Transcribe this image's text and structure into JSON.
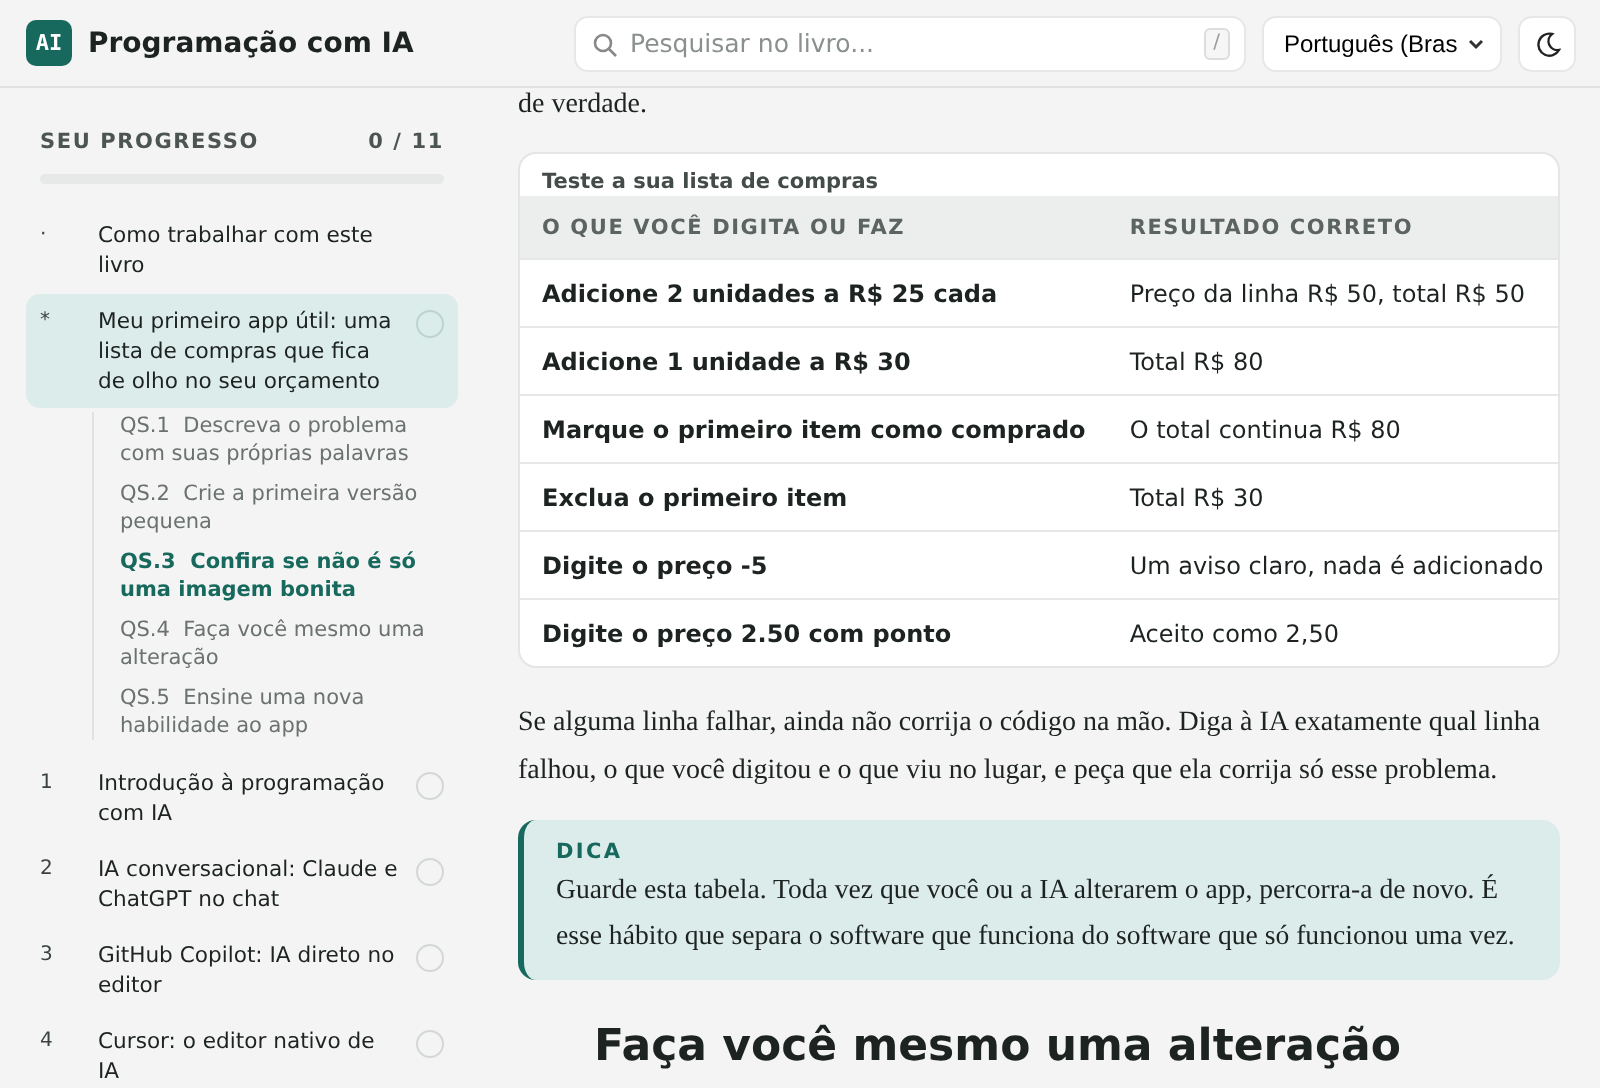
{
  "header": {
    "logo": "AI",
    "title": "Programação com IA",
    "search": {
      "placeholder": "Pesquisar no livro...",
      "shortcut": "/"
    },
    "language": "Português (Bras"
  },
  "sidebar": {
    "progress_label": "SEU PROGRESSO",
    "progress_count": "0 / 11",
    "level": 0,
    "chapters": [
      {
        "marker": "·",
        "title": "Como trabalhar com este livro",
        "selected": false
      },
      {
        "marker": "*",
        "title": "Meu primeiro app útil: uma lista de compras que fica de olho no seu orçamento",
        "selected": true,
        "completed": false,
        "children": [
          {
            "number": "QS.1",
            "title": "Descreva o problema com suas próprias palavras",
            "selected": false
          },
          {
            "number": "QS.2",
            "title": "Crie a primeira versão pequena",
            "selected": false
          },
          {
            "number": "QS.3",
            "title": "Confira se não é só uma imagem bonita",
            "selected": true
          },
          {
            "number": "QS.4",
            "title": "Faça você mesmo uma alteração",
            "selected": false
          },
          {
            "number": "QS.5",
            "title": "Ensine uma nova habilidade ao app",
            "selected": false
          }
        ]
      },
      {
        "marker": "1",
        "title": "Introdução à programação com IA",
        "selected": false,
        "completed": false
      },
      {
        "marker": "2",
        "title": "IA conversacional: Claude e ChatGPT no chat",
        "selected": false,
        "completed": false
      },
      {
        "marker": "3",
        "title": "GitHub Copilot: IA direto no editor",
        "selected": false,
        "completed": false
      },
      {
        "marker": "4",
        "title": "Cursor: o editor nativo de IA",
        "selected": false,
        "completed": false
      }
    ]
  },
  "content": {
    "lead_text": "de verdade.",
    "table": {
      "caption": "Teste a sua lista de compras",
      "columns": [
        "O QUE VOCÊ DIGITA OU FAZ",
        "RESULTADO CORRETO"
      ],
      "rows": [
        [
          "Adicione 2 unidades a R$ 25 cada",
          "Preço da linha R$ 50, total R$ 50"
        ],
        [
          "Adicione 1 unidade a R$ 30",
          "Total R$ 80"
        ],
        [
          "Marque o primeiro item como comprado",
          "O total continua R$ 80"
        ],
        [
          "Exclua o primeiro item",
          "Total R$ 30"
        ],
        [
          "Digite o preço -5",
          "Um aviso claro, nada é adicionado"
        ],
        [
          "Digite o preço 2.50 com ponto",
          "Aceito como 2,50"
        ]
      ]
    },
    "paragraph": "Se alguma linha falhar, ainda não corrija o código na mão. Diga à IA exatamente qual linha falhou, o que você digitou e o que viu no lugar, e peça que ela corrija só esse problema.",
    "tip": {
      "label": "DICA",
      "text": "Guarde esta tabela. Toda vez que você ou a IA alterarem o app, percorra-a de novo. É esse hábito que separa o software que funciona do software que só funcionou uma vez."
    },
    "heading": "Faça você mesmo uma alteração"
  }
}
